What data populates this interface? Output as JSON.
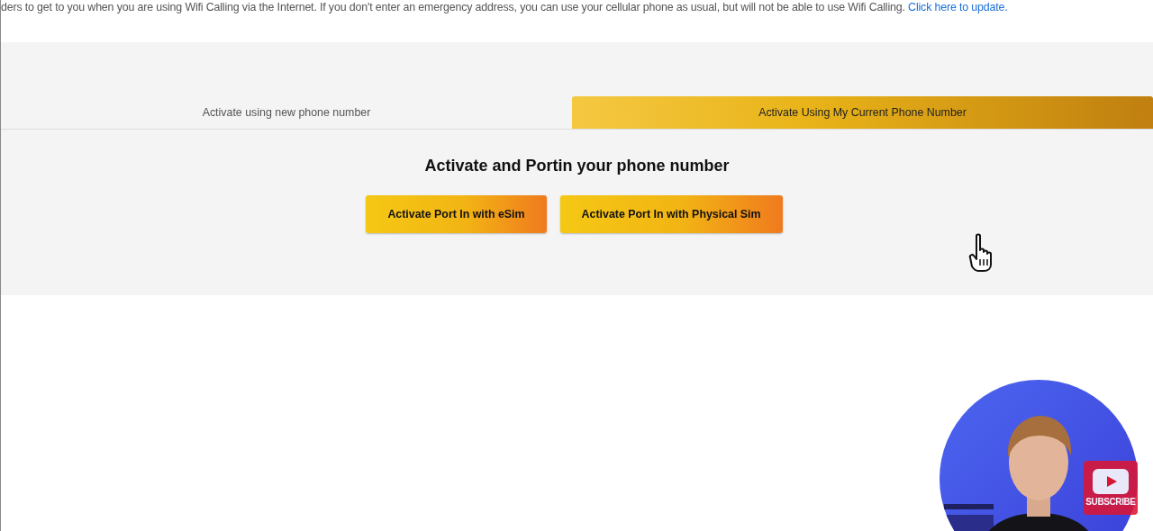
{
  "notice": {
    "text": "ders to get to you when you are using Wifi Calling via the Internet. If you don't enter an emergency address, you can use your cellular phone as usual, but will not be able to use Wifi Calling.",
    "link": "Click here to update."
  },
  "tabs": [
    {
      "label": "Activate using new phone number",
      "selected": false
    },
    {
      "label": "Activate Using My Current Phone Number",
      "selected": true
    }
  ],
  "heading": "Activate and Portin your phone number",
  "buttons": [
    "Activate Port In with eSim",
    "Activate Port In with Physical Sim"
  ],
  "video_overlay": {
    "kind": "picture",
    "badge": "SUBSCRIBE"
  }
}
